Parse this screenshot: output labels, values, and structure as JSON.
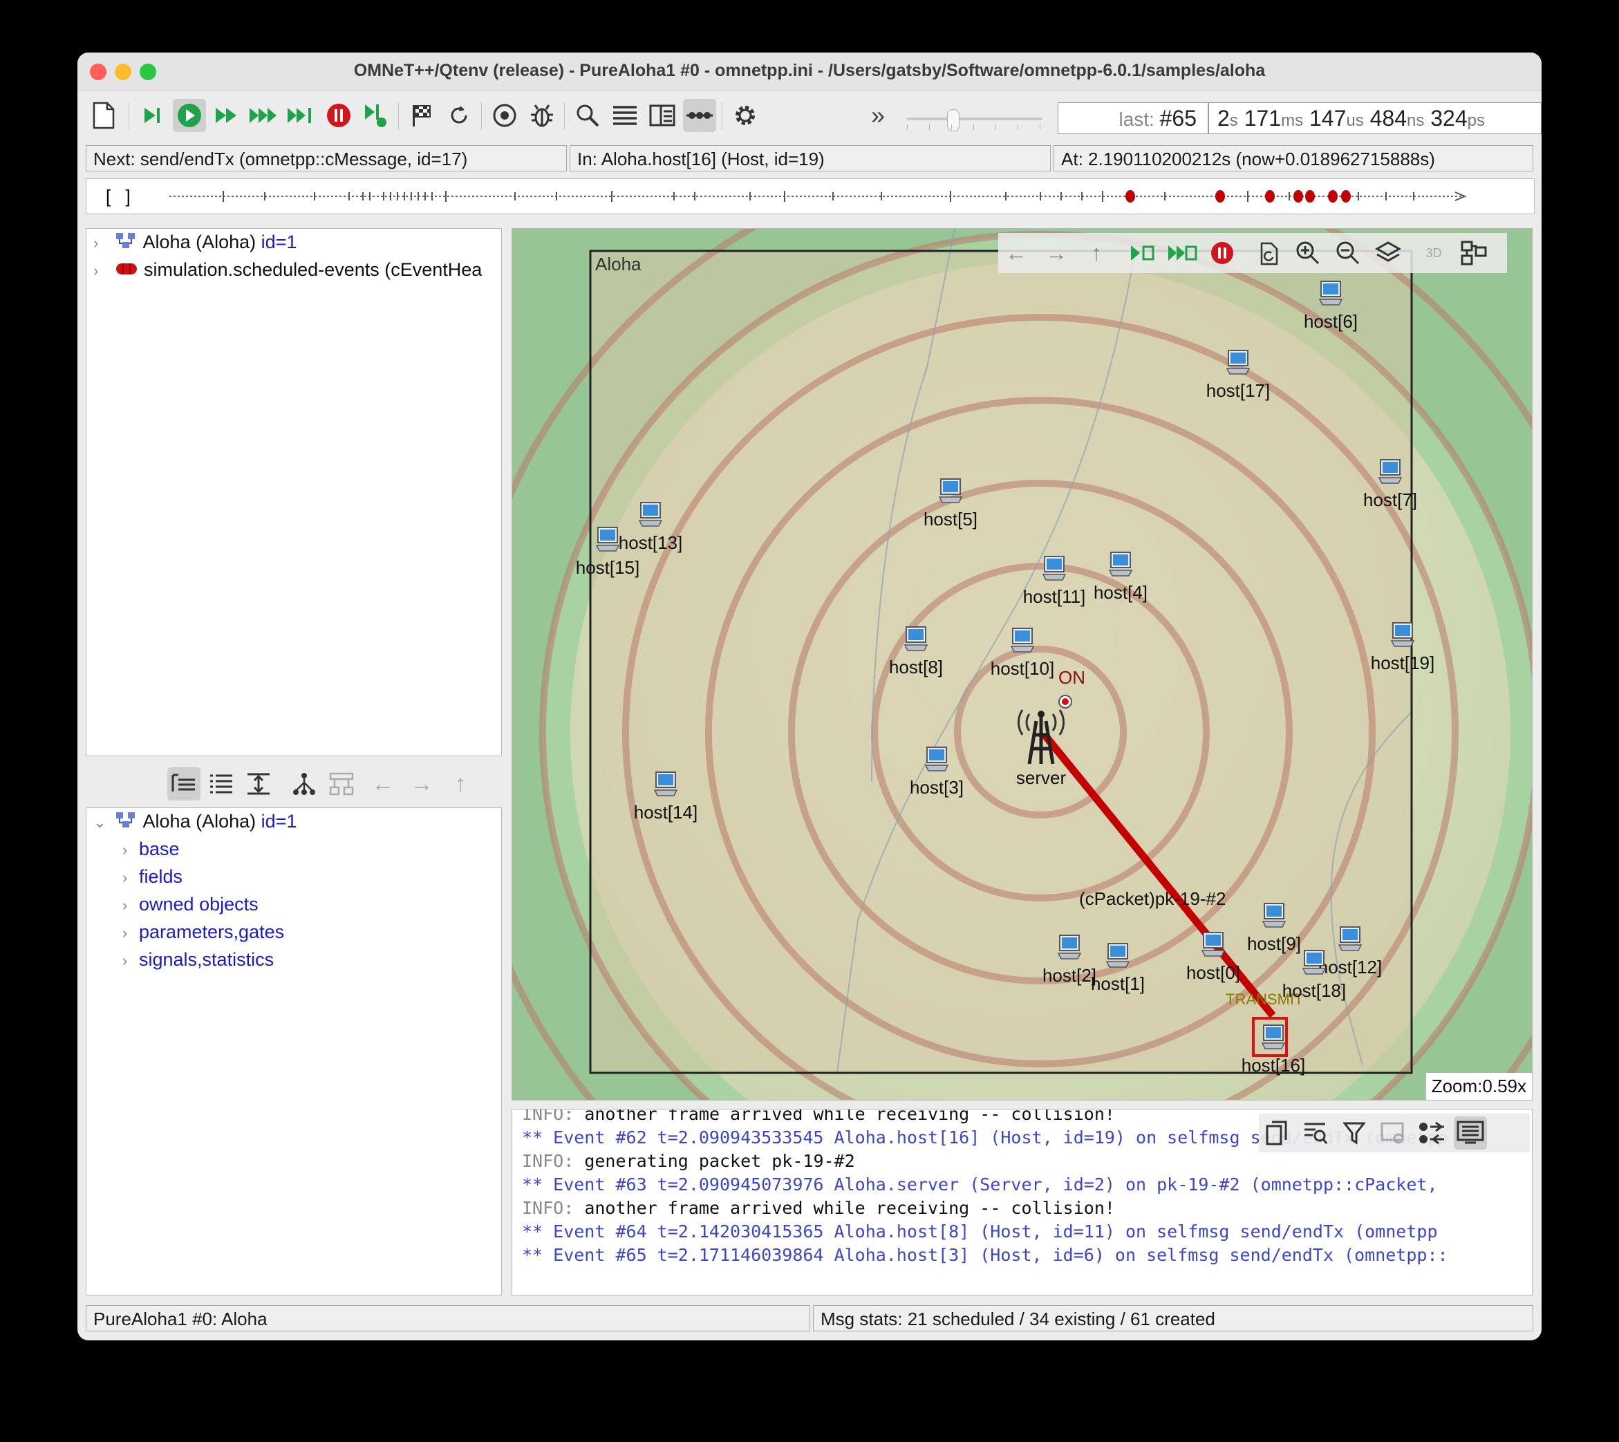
{
  "window": {
    "title": "OMNeT++/Qtenv (release) - PureAloha1 #0 - omnetpp.ini - /Users/gatsby/Software/omnetpp-6.0.1/samples/aloha"
  },
  "toolbar": {
    "last_label": "last:",
    "last_value": "#65",
    "time": {
      "s": "2",
      "s_u": "s",
      "ms": "171",
      "ms_u": "ms",
      "us": "147",
      "us_u": "us",
      "ns": "484",
      "ns_u": "ns",
      "ps": "324",
      "ps_u": "ps"
    },
    "more": "»"
  },
  "status": {
    "next": "Next: send/endTx (omnetpp::cMessage, id=17)",
    "in": "In: Aloha.host[16] (Host, id=19)",
    "at": "At: 2.190110200212s (now+0.018962715888s)"
  },
  "timeline": {
    "brackets": "[ ]"
  },
  "object_tree": {
    "items": [
      {
        "label": "Aloha (Aloha)",
        "id": "id=1"
      },
      {
        "label": "simulation.scheduled-events (cEventHea",
        "id": ""
      }
    ]
  },
  "inspector": {
    "root": {
      "label": "Aloha (Aloha)",
      "id": "id=1"
    },
    "items": [
      "base",
      "fields",
      "owned objects",
      "parameters,gates",
      "signals,statistics"
    ]
  },
  "canvas": {
    "module_name": "Aloha",
    "zoom": "Zoom:0.59x",
    "server_label": "server",
    "server_state": "ON",
    "packet_label": "(cPacket)pk-19-#2",
    "tx_label": "TRANSMIT",
    "hosts": [
      {
        "name": "host[6]"
      },
      {
        "name": "host[17]"
      },
      {
        "name": "host[7]"
      },
      {
        "name": "host[5]"
      },
      {
        "name": "host[13]"
      },
      {
        "name": "host[15]"
      },
      {
        "name": "host[11]"
      },
      {
        "name": "host[4]"
      },
      {
        "name": "host[19]"
      },
      {
        "name": "host[8]"
      },
      {
        "name": "host[10]"
      },
      {
        "name": "host[3]"
      },
      {
        "name": "host[14]"
      },
      {
        "name": "host[9]"
      },
      {
        "name": "host[12]"
      },
      {
        "name": "host[2]"
      },
      {
        "name": "host[1]"
      },
      {
        "name": "host[0]"
      },
      {
        "name": "host[18]"
      },
      {
        "name": "host[16]"
      }
    ]
  },
  "log": {
    "lines": [
      {
        "type": "info",
        "prefix": "INFO:",
        "text": "another frame arrived while receiving -- collision!"
      },
      {
        "type": "event",
        "text": "** Event #62  t=2.090943533545  Aloha.host[16] (Host, id=19)  on selfmsg send/endTx (omnetpp"
      },
      {
        "type": "info",
        "prefix": "INFO:",
        "text": "generating packet pk-19-#2"
      },
      {
        "type": "event",
        "text": "** Event #63  t=2.090945073976  Aloha.server (Server, id=2)  on pk-19-#2 (omnetpp::cPacket,"
      },
      {
        "type": "info",
        "prefix": "INFO:",
        "text": "another frame arrived while receiving -- collision!"
      },
      {
        "type": "event",
        "text": "** Event #64  t=2.142030415365  Aloha.host[8] (Host, id=11)  on selfmsg send/endTx (omnetpp"
      },
      {
        "type": "event",
        "text": "** Event #65  t=2.171146039864  Aloha.host[3] (Host, id=6)  on selfmsg send/endTx (omnetpp::"
      }
    ]
  },
  "bottom_status": {
    "left": "PureAloha1 #0: Aloha",
    "right": "Msg stats: 21 scheduled / 34 existing / 61 created"
  },
  "colors": {
    "accent_green": "#1fa34a",
    "stop_red": "#d0151c",
    "packet_red": "#c40000",
    "event_blue": "#3b46c9"
  }
}
